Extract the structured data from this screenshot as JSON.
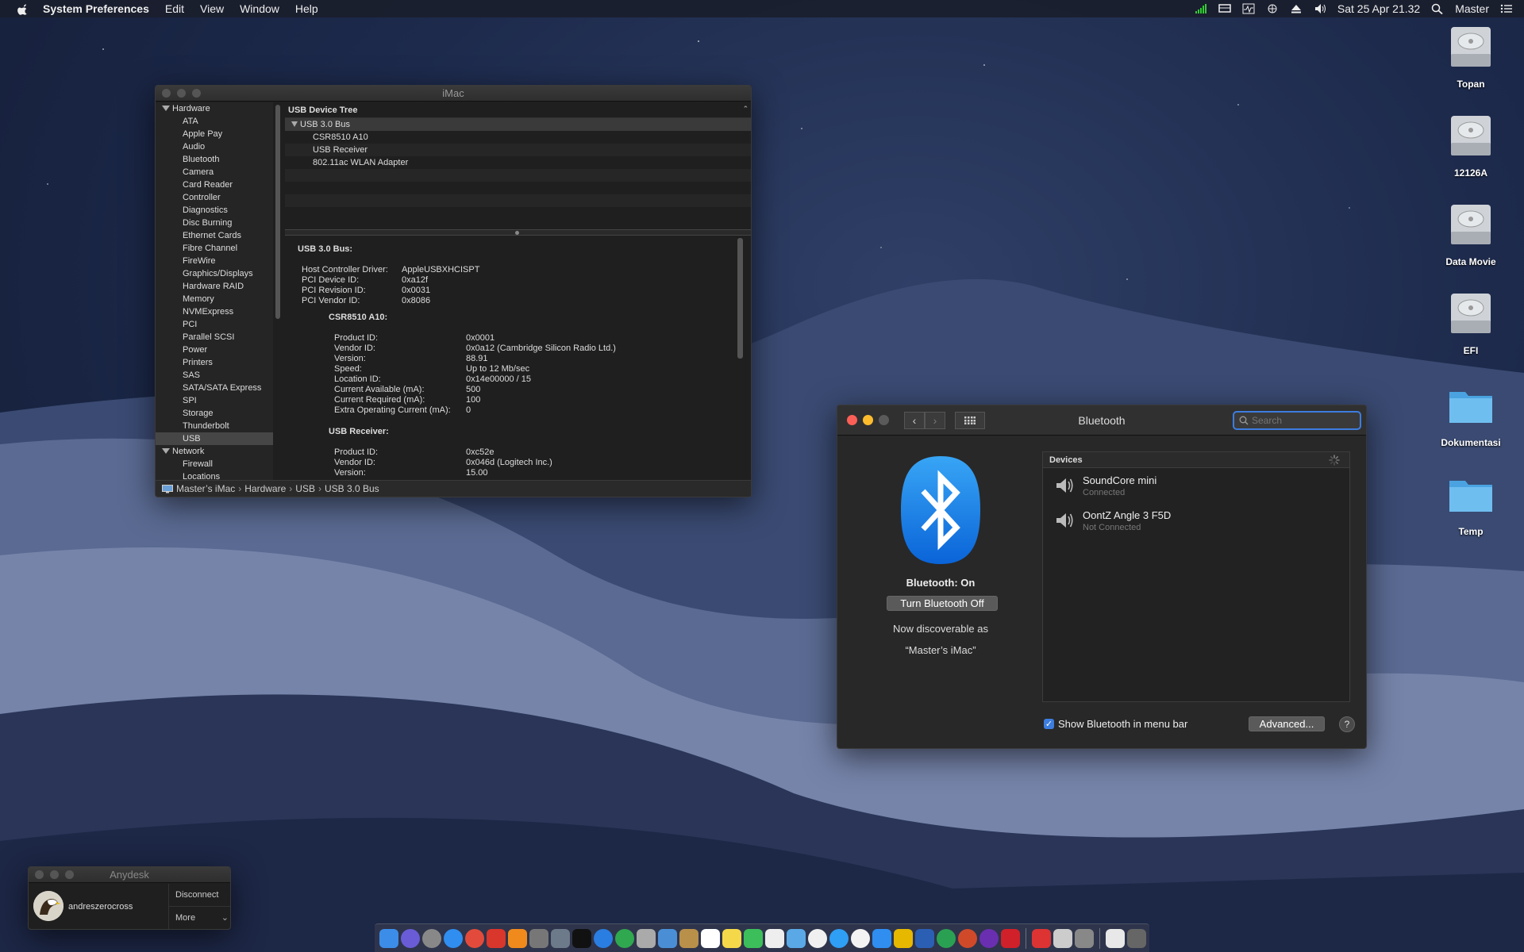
{
  "menubar": {
    "app_name": "System Preferences",
    "menus": [
      "Edit",
      "View",
      "Window",
      "Help"
    ],
    "datetime": "Sat 25 Apr  21.32",
    "user": "Master"
  },
  "desktop_icons": [
    {
      "label": "Topan",
      "type": "disk"
    },
    {
      "label": "12126A",
      "type": "disk"
    },
    {
      "label": "Data Movie",
      "type": "disk"
    },
    {
      "label": "EFI",
      "type": "disk"
    },
    {
      "label": "Dokumentasi",
      "type": "folder"
    },
    {
      "label": "Temp",
      "type": "folder"
    }
  ],
  "sysinfo": {
    "title": "iMac",
    "sidebar": {
      "hardware_label": "Hardware",
      "hardware_items": [
        "ATA",
        "Apple Pay",
        "Audio",
        "Bluetooth",
        "Camera",
        "Card Reader",
        "Controller",
        "Diagnostics",
        "Disc Burning",
        "Ethernet Cards",
        "Fibre Channel",
        "FireWire",
        "Graphics/Displays",
        "Hardware RAID",
        "Memory",
        "NVMExpress",
        "PCI",
        "Parallel SCSI",
        "Power",
        "Printers",
        "SAS",
        "SATA/SATA Express",
        "SPI",
        "Storage",
        "Thunderbolt",
        "USB"
      ],
      "selected": "USB",
      "network_label": "Network",
      "network_items": [
        "Firewall",
        "Locations"
      ]
    },
    "tree": {
      "header": "USB Device Tree",
      "root": "USB 3.0 Bus",
      "children": [
        "CSR8510 A10",
        "USB Receiver",
        "802.11ac WLAN Adapter"
      ]
    },
    "detail": {
      "title": "USB 3.0 Bus:",
      "bus_props": [
        {
          "k": "Host Controller Driver:",
          "v": "AppleUSBXHCISPT"
        },
        {
          "k": "PCI Device ID:",
          "v": "0xa12f"
        },
        {
          "k": "PCI Revision ID:",
          "v": "0x0031"
        },
        {
          "k": "PCI Vendor ID:",
          "v": "0x8086"
        }
      ],
      "dev1_title": "CSR8510 A10:",
      "dev1_props": [
        {
          "k": "Product ID:",
          "v": "0x0001"
        },
        {
          "k": "Vendor ID:",
          "v": "0x0a12  (Cambridge Silicon Radio Ltd.)"
        },
        {
          "k": "Version:",
          "v": "88.91"
        },
        {
          "k": "Speed:",
          "v": "Up to 12 Mb/sec"
        },
        {
          "k": "Location ID:",
          "v": "0x14e00000 / 15"
        },
        {
          "k": "Current Available (mA):",
          "v": "500"
        },
        {
          "k": "Current Required (mA):",
          "v": "100"
        },
        {
          "k": "Extra Operating Current (mA):",
          "v": "0"
        }
      ],
      "dev2_title": "USB Receiver:",
      "dev2_props": [
        {
          "k": "Product ID:",
          "v": "0xc52e"
        },
        {
          "k": "Vendor ID:",
          "v": "0x046d  (Logitech Inc.)"
        },
        {
          "k": "Version:",
          "v": "15.00"
        }
      ]
    },
    "path": [
      "Master’s iMac",
      "Hardware",
      "USB",
      "USB 3.0 Bus"
    ]
  },
  "bluetooth": {
    "title": "Bluetooth",
    "search_placeholder": "Search",
    "status": "Bluetooth: On",
    "toggle_label": "Turn Bluetooth Off",
    "discoverable_line1": "Now discoverable as",
    "discoverable_line2": "“Master’s iMac”",
    "devices_header": "Devices",
    "devices": [
      {
        "name": "SoundCore mini",
        "status": "Connected"
      },
      {
        "name": "OontZ Angle 3 F5D",
        "status": "Not Connected"
      }
    ],
    "show_in_menubar_label": "Show Bluetooth in menu bar",
    "show_in_menubar_checked": true,
    "advanced_label": "Advanced...",
    "help_label": "?",
    "accent_color": "#3d7de0"
  },
  "anydesk": {
    "title": "Anydesk",
    "user": "andreszerocross",
    "disconnect_label": "Disconnect",
    "more_label": "More"
  }
}
